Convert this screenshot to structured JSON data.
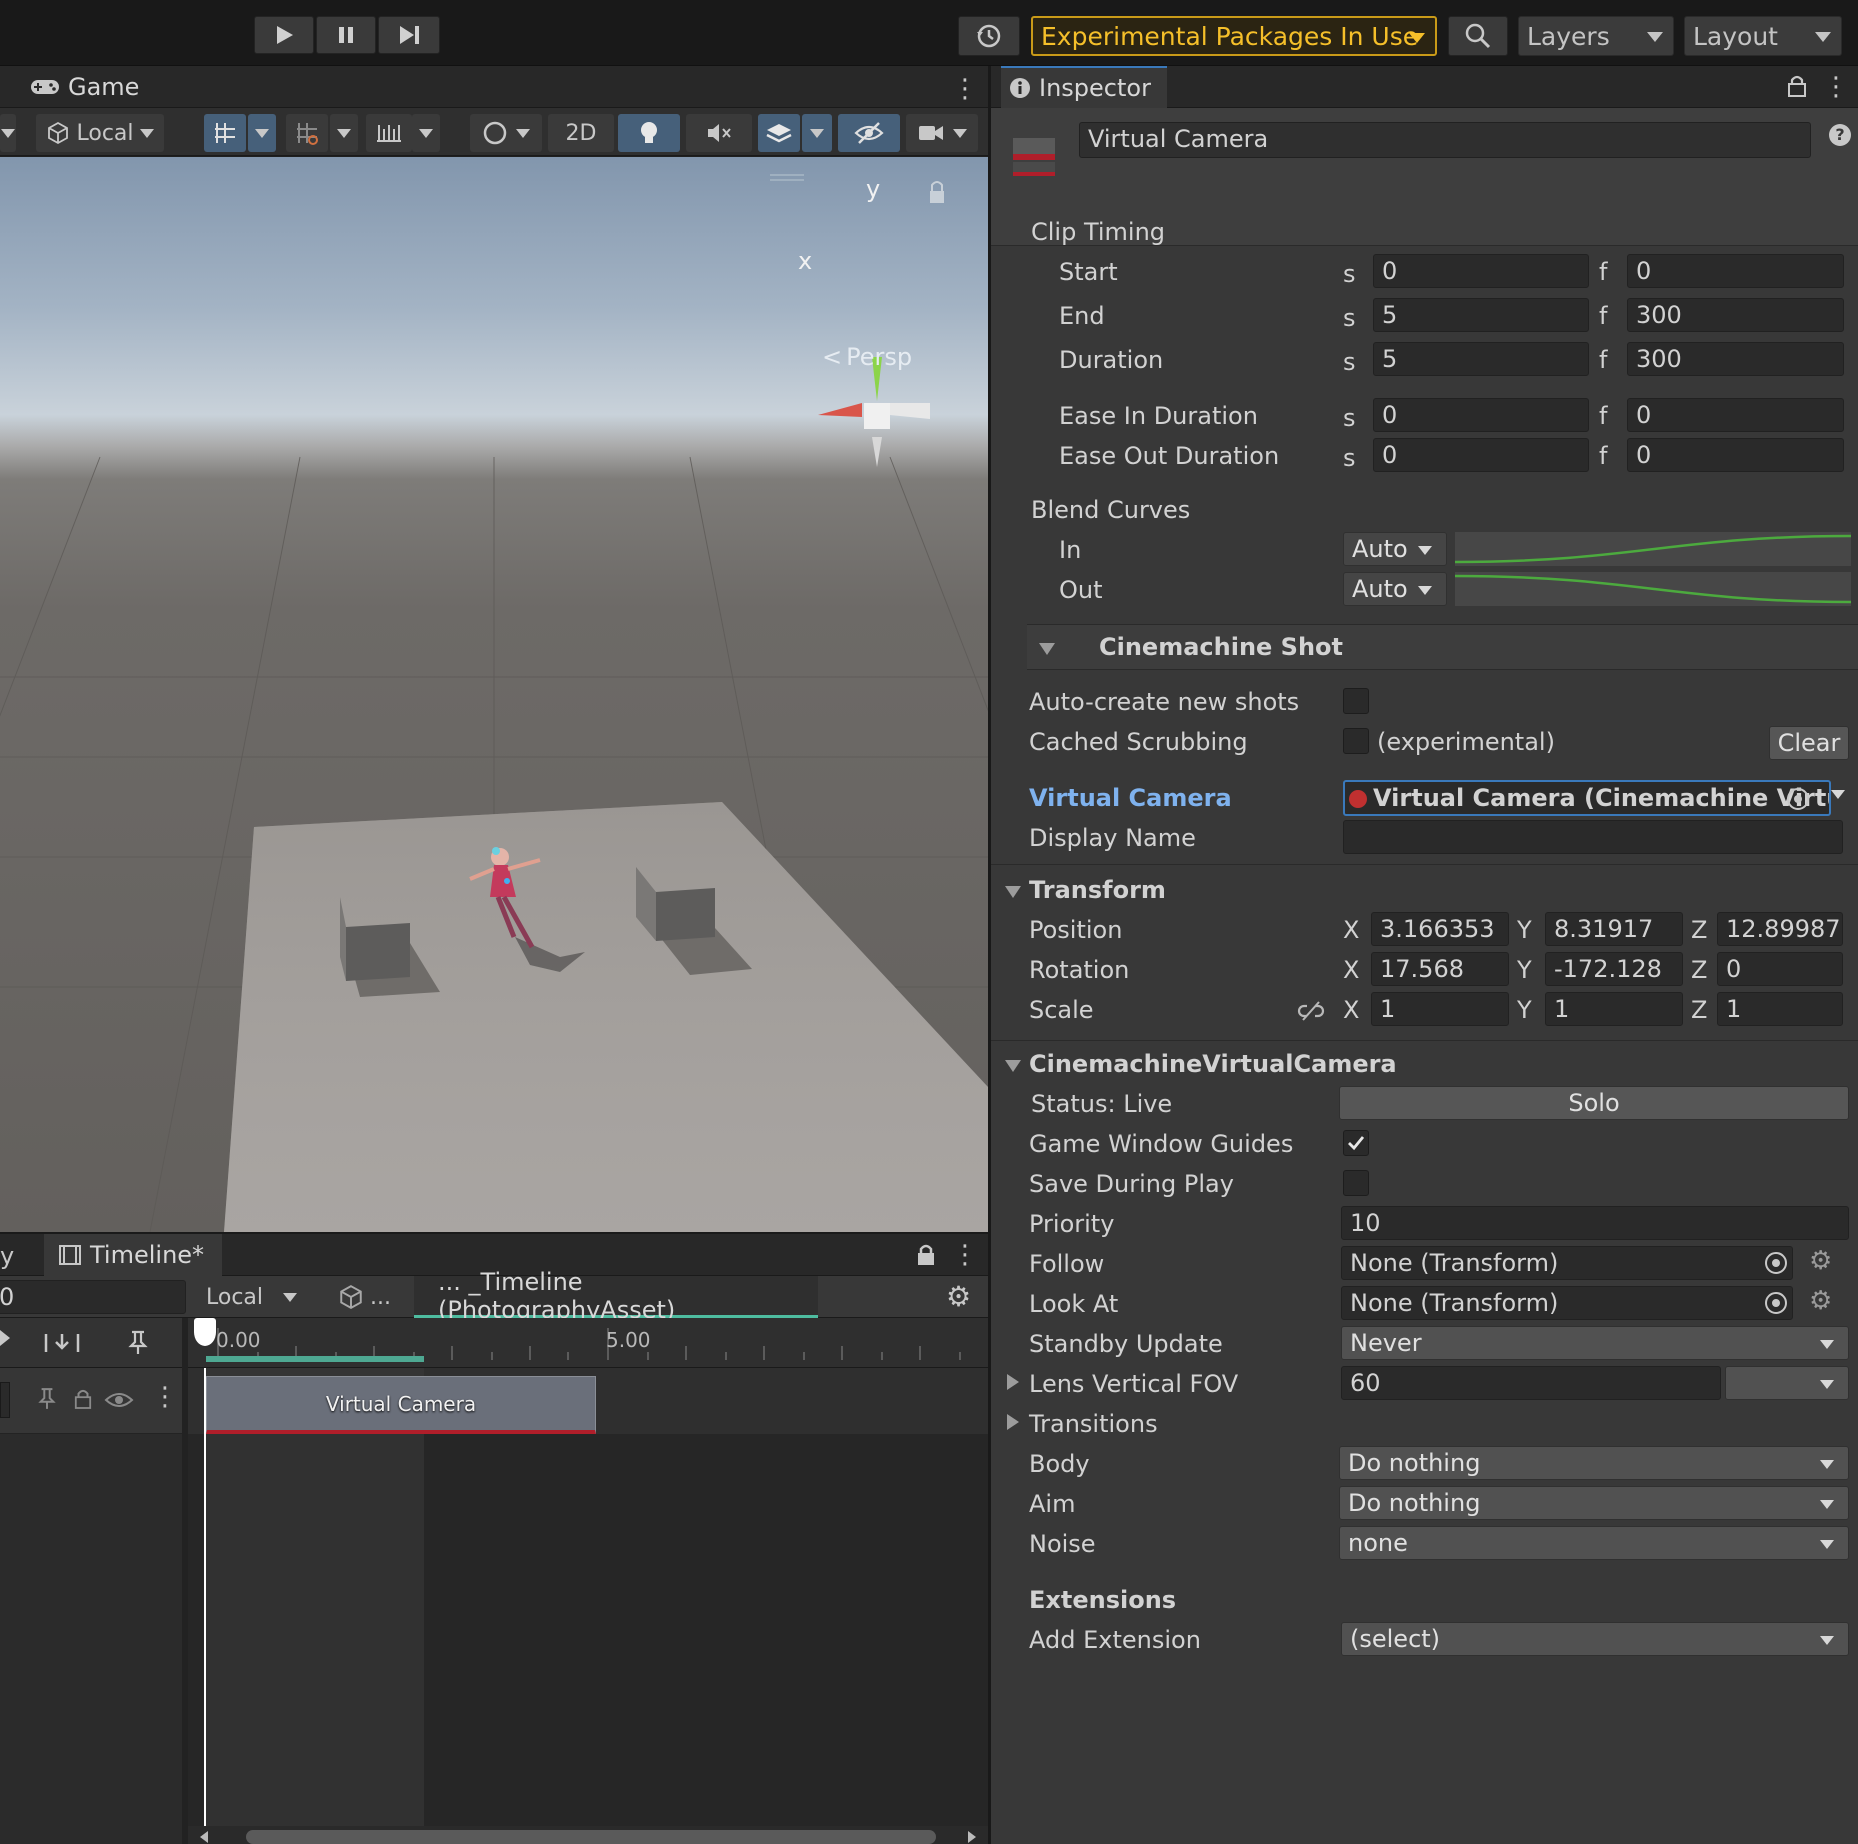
{
  "toolbar": {
    "experimental_label": "Experimental Packages In Use",
    "layers_label": "Layers",
    "layout_label": "Layout"
  },
  "scene": {
    "tab_label": "Game",
    "pivot_label": "Local",
    "mode_2d": "2D",
    "gizmo_y": "y",
    "gizmo_x": "x",
    "persp_label": "Persp"
  },
  "timeline": {
    "tab_label": "Timeline*",
    "prev_tab_fragment": "y",
    "frame_field": "0",
    "space_label": "Local",
    "breadcrumb_ellipsis": "...",
    "asset_label": "... _Timeline (PhotographyAsset)",
    "ruler_start": "0.00",
    "ruler_mid": "5.00",
    "clip_label": "Virtual Camera"
  },
  "inspector": {
    "tab_label": "Inspector",
    "object_name": "Virtual Camera",
    "help_icon": "?",
    "clip_timing": {
      "title": "Clip Timing",
      "s": "s",
      "f": "f",
      "rows": [
        {
          "label": "Start",
          "s": "0",
          "f": "0"
        },
        {
          "label": "End",
          "s": "5",
          "f": "300"
        },
        {
          "label": "Duration",
          "s": "5",
          "f": "300"
        },
        {
          "label": "Ease In Duration",
          "s": "0",
          "f": "0"
        },
        {
          "label": "Ease Out Duration",
          "s": "0",
          "f": "0"
        }
      ]
    },
    "blend_curves": {
      "title": "Blend Curves",
      "in_label": "In",
      "in_value": "Auto",
      "out_label": "Out",
      "out_value": "Auto"
    },
    "shot": {
      "title": "Cinemachine Shot",
      "auto_create_label": "Auto-create new shots",
      "cached_label": "Cached Scrubbing",
      "experimental_label": "(experimental)",
      "clear_label": "Clear",
      "vcam_label": "Virtual Camera",
      "vcam_value": "Virtual Camera (Cinemachine Virtu",
      "display_name_label": "Display Name",
      "display_name_value": ""
    },
    "transform": {
      "title": "Transform",
      "x": "X",
      "y": "Y",
      "z": "Z",
      "position_label": "Position",
      "position": [
        "3.166353",
        "8.31917",
        "12.89987"
      ],
      "rotation_label": "Rotation",
      "rotation": [
        "17.568",
        "-172.128",
        "0"
      ],
      "scale_label": "Scale",
      "scale": [
        "1",
        "1",
        "1"
      ]
    },
    "vcam": {
      "title": "CinemachineVirtualCamera",
      "status_label": "Status: Live",
      "solo_label": "Solo",
      "guides_label": "Game Window Guides",
      "save_label": "Save During Play",
      "priority_label": "Priority",
      "priority_value": "10",
      "follow_label": "Follow",
      "follow_value": "None (Transform)",
      "lookat_label": "Look At",
      "lookat_value": "None (Transform)",
      "standby_label": "Standby Update",
      "standby_value": "Never",
      "fov_label": "Lens Vertical FOV",
      "fov_value": "60",
      "transitions_label": "Transitions",
      "body_label": "Body",
      "body_value": "Do nothing",
      "aim_label": "Aim",
      "aim_value": "Do nothing",
      "noise_label": "Noise",
      "noise_value": "none",
      "extensions_title": "Extensions",
      "add_extension_label": "Add Extension",
      "add_extension_value": "(select)"
    }
  }
}
